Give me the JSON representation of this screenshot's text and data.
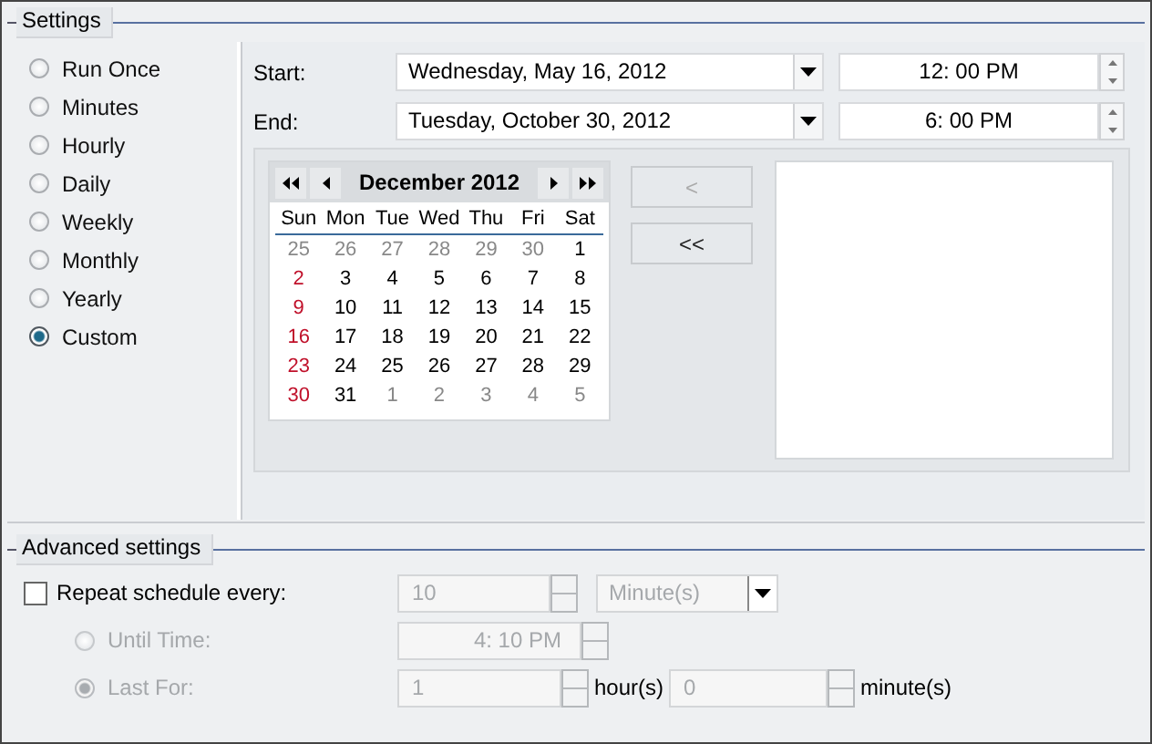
{
  "settings": {
    "title": "Settings",
    "frequencies": [
      {
        "label": "Run Once",
        "selected": false
      },
      {
        "label": "Minutes",
        "selected": false
      },
      {
        "label": "Hourly",
        "selected": false
      },
      {
        "label": "Daily",
        "selected": false
      },
      {
        "label": "Weekly",
        "selected": false
      },
      {
        "label": "Monthly",
        "selected": false
      },
      {
        "label": "Yearly",
        "selected": false
      },
      {
        "label": "Custom",
        "selected": true
      }
    ],
    "start": {
      "label": "Start:",
      "date": "Wednesday, May 16, 2012",
      "time": "12: 00 PM"
    },
    "end": {
      "label": "End:",
      "date": "Tuesday, October 30, 2012",
      "time": "6: 00 PM"
    },
    "calendar": {
      "title": "December 2012",
      "weekdays": [
        "Sun",
        "Mon",
        "Tue",
        "Wed",
        "Thu",
        "Fri",
        "Sat"
      ],
      "weeks": [
        [
          {
            "day": "25",
            "muted": true
          },
          {
            "day": "26",
            "muted": true
          },
          {
            "day": "27",
            "muted": true
          },
          {
            "day": "28",
            "muted": true
          },
          {
            "day": "29",
            "muted": true
          },
          {
            "day": "30",
            "muted": true
          },
          {
            "day": "1",
            "muted": false
          }
        ],
        [
          {
            "day": "2",
            "muted": false
          },
          {
            "day": "3",
            "muted": false
          },
          {
            "day": "4",
            "muted": false
          },
          {
            "day": "5",
            "muted": false
          },
          {
            "day": "6",
            "muted": false
          },
          {
            "day": "7",
            "muted": false
          },
          {
            "day": "8",
            "muted": false
          }
        ],
        [
          {
            "day": "9",
            "muted": false
          },
          {
            "day": "10",
            "muted": false
          },
          {
            "day": "11",
            "muted": false
          },
          {
            "day": "12",
            "muted": false
          },
          {
            "day": "13",
            "muted": false
          },
          {
            "day": "14",
            "muted": false
          },
          {
            "day": "15",
            "muted": false
          }
        ],
        [
          {
            "day": "16",
            "muted": false
          },
          {
            "day": "17",
            "muted": false
          },
          {
            "day": "18",
            "muted": false
          },
          {
            "day": "19",
            "muted": false
          },
          {
            "day": "20",
            "muted": false
          },
          {
            "day": "21",
            "muted": false
          },
          {
            "day": "22",
            "muted": false
          }
        ],
        [
          {
            "day": "23",
            "muted": false
          },
          {
            "day": "24",
            "muted": false
          },
          {
            "day": "25",
            "muted": false
          },
          {
            "day": "26",
            "muted": false
          },
          {
            "day": "27",
            "muted": false
          },
          {
            "day": "28",
            "muted": false
          },
          {
            "day": "29",
            "muted": false
          }
        ],
        [
          {
            "day": "30",
            "muted": false
          },
          {
            "day": "31",
            "muted": false
          },
          {
            "day": "1",
            "muted": true
          },
          {
            "day": "2",
            "muted": true
          },
          {
            "day": "3",
            "muted": true
          },
          {
            "day": "4",
            "muted": true
          },
          {
            "day": "5",
            "muted": true
          }
        ]
      ]
    },
    "buttons": [
      {
        "label": "<",
        "disabled": true
      },
      {
        "label": "<<",
        "disabled": false
      }
    ]
  },
  "advanced": {
    "title": "Advanced settings",
    "repeat": {
      "label": "Repeat schedule every:",
      "checked": false,
      "disabled": true,
      "value": "10",
      "unit": "Minute(s)"
    },
    "until": {
      "label": "Until Time:",
      "selected": false,
      "disabled": true,
      "value": "4: 10 PM"
    },
    "last_for": {
      "label": "Last For:",
      "selected": true,
      "disabled": true,
      "hours": "1",
      "hours_unit": "hour(s)",
      "minutes": "0",
      "minutes_unit": "minute(s)"
    }
  }
}
